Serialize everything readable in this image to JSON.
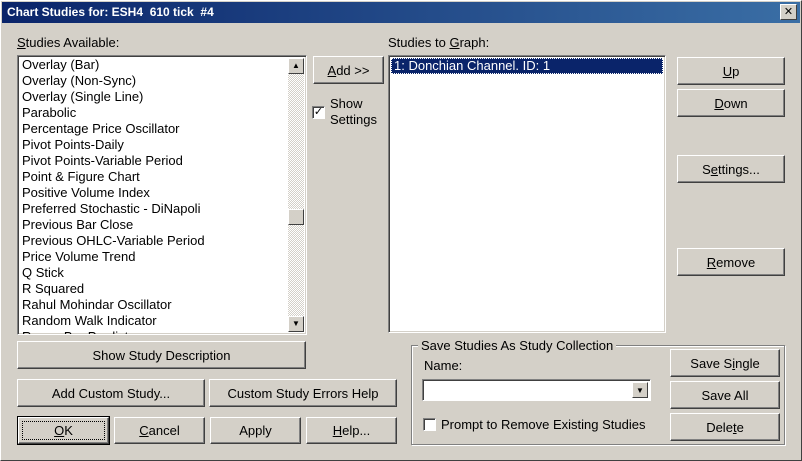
{
  "window": {
    "title": "Chart Studies for: ESH4  610 tick  #4",
    "close_symbol": "✕"
  },
  "studies_available": {
    "label_pre": "",
    "label_accel": "S",
    "label_post": "tudies Available:",
    "items": [
      "Overlay (Bar)",
      "Overlay (Non-Sync)",
      "Overlay (Single Line)",
      "Parabolic",
      "Percentage Price Oscillator",
      "Pivot Points-Daily",
      "Pivot Points-Variable Period",
      "Point & Figure Chart",
      "Positive Volume Index",
      "Preferred Stochastic - DiNapoli",
      "Previous Bar Close",
      "Previous OHLC-Variable Period",
      "Price Volume Trend",
      "Q Stick",
      "R Squared",
      "Rahul Mohindar Oscillator",
      "Random Walk Indicator",
      "Range Bar Predictor"
    ]
  },
  "add_button": {
    "accel": "A",
    "rest": "dd >>"
  },
  "show_settings": {
    "label_line1": "Show",
    "label_line2": "Settings",
    "checked": true,
    "check_symbol": "✓"
  },
  "studies_to_graph": {
    "label_pre": "Studies to ",
    "label_accel": "G",
    "label_post": "raph:",
    "items": [
      "1: Donchian Channel. ID: 1"
    ]
  },
  "right_buttons": {
    "up": {
      "accel": "U",
      "rest": "p"
    },
    "down": {
      "accel": "D",
      "rest": "own"
    },
    "settings": {
      "pre": "S",
      "accel": "e",
      "rest": "ttings..."
    },
    "remove": {
      "accel": "R",
      "rest": "emove"
    }
  },
  "show_study_description": "Show Study Description",
  "add_custom_study": "Add Custom Study...",
  "custom_study_errors_help": "Custom Study Errors Help",
  "ok_button": {
    "accel": "O",
    "rest": "K"
  },
  "cancel_button": {
    "accel": "C",
    "rest": "ancel"
  },
  "apply_button": "Apply",
  "help_button": {
    "accel": "H",
    "rest": "elp..."
  },
  "save_collection": {
    "group_title": "Save Studies As Study Collection",
    "name_label": "Name:",
    "name_value": "",
    "prompt_label": "Prompt to Remove Existing Studies",
    "prompt_checked": false,
    "save_single": {
      "pre": "Save S",
      "accel": "i",
      "rest": "ngle"
    },
    "save_all": "Save All",
    "delete": {
      "pre": "Dele",
      "accel": "t",
      "rest": "e"
    }
  },
  "icons": {
    "scroll_up": "▲",
    "scroll_down": "▼",
    "combo_drop": "▼"
  }
}
